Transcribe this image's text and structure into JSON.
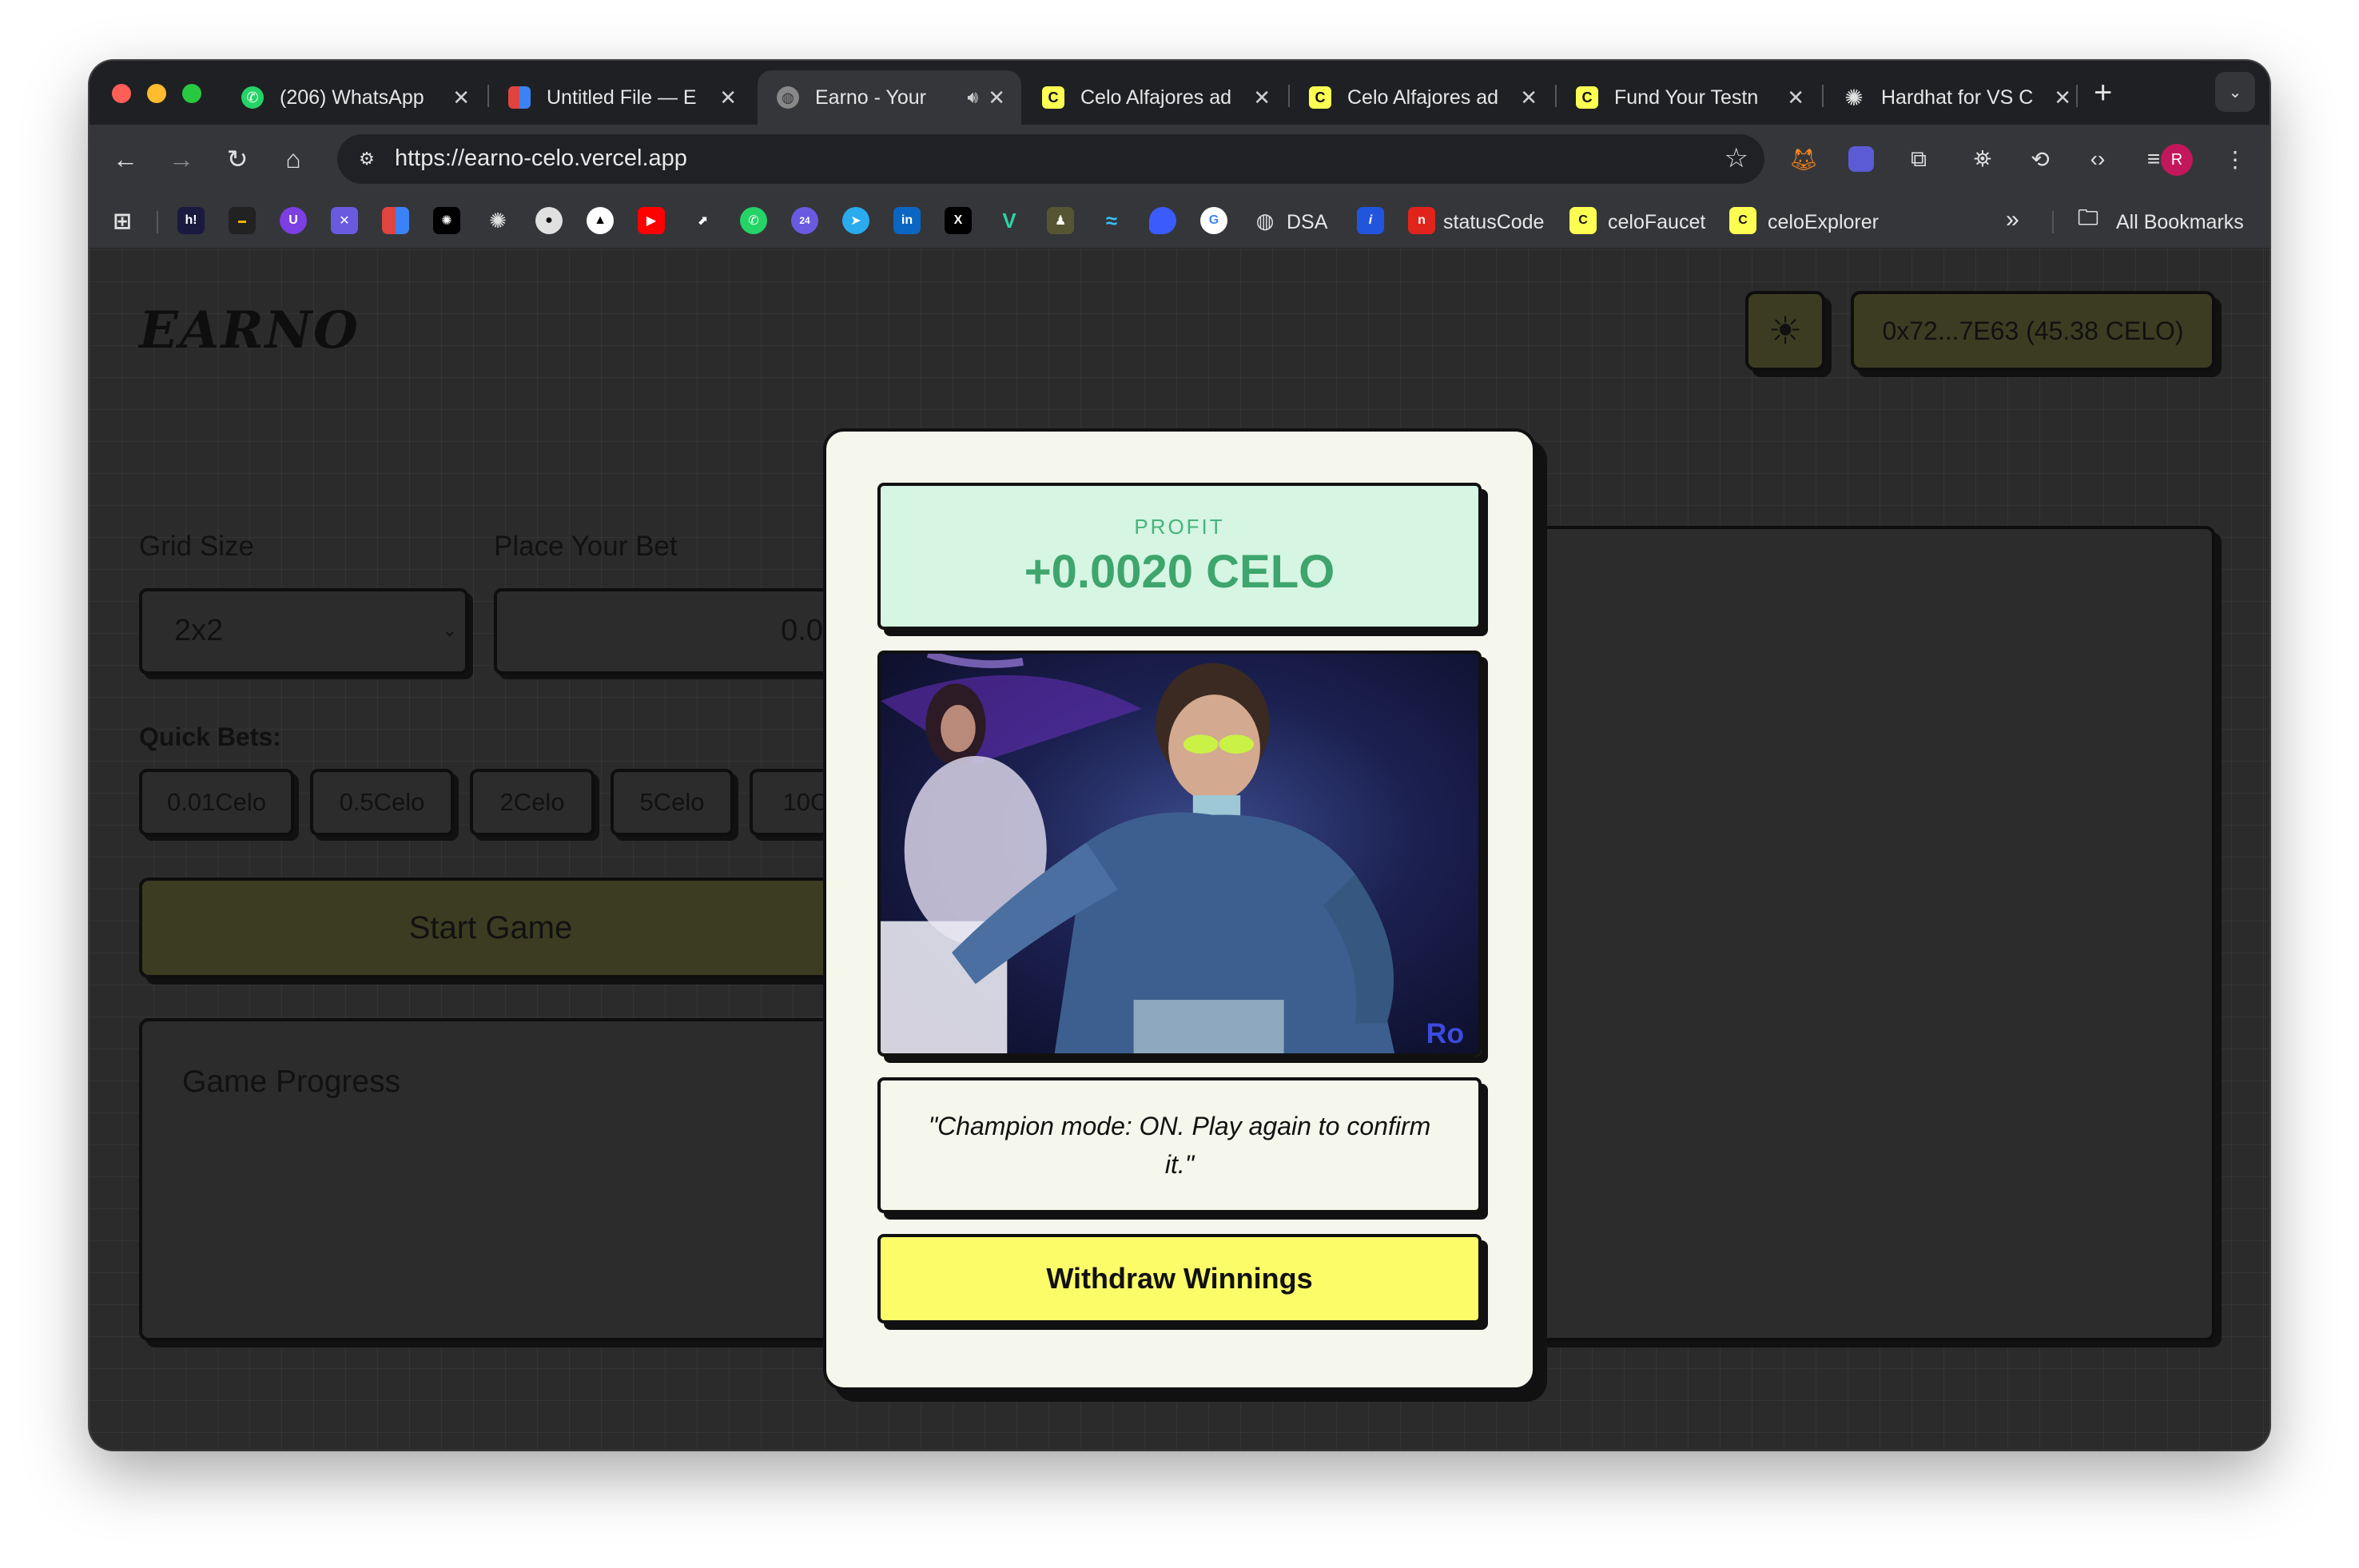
{
  "browser": {
    "tabs": [
      {
        "title": "(206) WhatsApp",
        "favicon": "whatsapp-icon",
        "active": false
      },
      {
        "title": "Untitled File — E",
        "favicon": "excalidraw-icon",
        "active": false
      },
      {
        "title": "Earno - Your",
        "favicon": "globe-icon",
        "active": true,
        "audio": true
      },
      {
        "title": "Celo Alfajores ad",
        "favicon": "celo-icon",
        "active": false
      },
      {
        "title": "Celo Alfajores ad",
        "favicon": "celo-icon",
        "active": false
      },
      {
        "title": "Fund Your Testn",
        "favicon": "celo-icon",
        "active": false
      },
      {
        "title": "Hardhat for VS C",
        "favicon": "openai-icon",
        "active": false
      }
    ],
    "url": "https://earno-celo.vercel.app",
    "profile_initial": "R",
    "bookmarks": {
      "dsa": "DSA",
      "status_code": "statusCode",
      "celo_faucet": "celoFaucet",
      "celo_explorer": "celoExplorer",
      "all_bookmarks": "All Bookmarks",
      "overflow": "»"
    }
  },
  "app": {
    "logo": "EARNO",
    "wallet": "0x72...7E63 (45.38 CELO)",
    "grid_size_label": "Grid Size",
    "grid_size_value": "2x2",
    "bet_label": "Place Your Bet",
    "bet_value": "0.0",
    "quick_bets_label": "Quick Bets:",
    "quick_bets": [
      "0.01Celo",
      "0.5Celo",
      "2Celo",
      "5Celo",
      "10C"
    ],
    "start_button": "Start Game",
    "progress_title": "Game Progress"
  },
  "modal": {
    "profit_label": "PROFIT",
    "profit_value": "+0.0020 CELO",
    "gif_watermark": "Ro",
    "quote": "\"Champion mode: ON. Play again to confirm it.\"",
    "withdraw_button": "Withdraw Winnings"
  },
  "colors": {
    "accent_yellow": "#fbfc68",
    "profit_green": "#3ea56d",
    "profit_bg": "#d6f5e3",
    "modal_bg": "#f5f7ec"
  }
}
